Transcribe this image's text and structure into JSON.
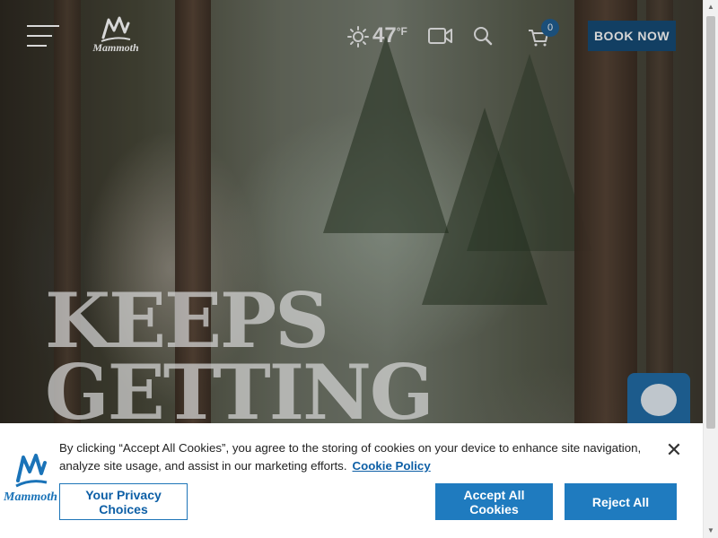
{
  "header": {
    "menu_icon": "hamburger-menu-icon",
    "logo_text": "Mammoth",
    "weather": {
      "icon": "sun-icon",
      "temperature": "47",
      "unit": "°F"
    },
    "webcam_icon": "video-camera-icon",
    "search_icon": "search-icon",
    "cart": {
      "icon": "cart-icon",
      "count": "0"
    },
    "book_label": "BOOK NOW"
  },
  "hero": {
    "headline_line1": "KEEPS",
    "headline_line2": "GETTING"
  },
  "chat": {
    "icon": "chat-bubble-icon"
  },
  "cookie_banner": {
    "logo_text": "Mammoth",
    "message": "By clicking “Accept All Cookies”, you agree to the storing of cookies on your device to enhance site navigation, analyze site usage, and assist in our marketing efforts.",
    "policy_link": "Cookie Policy",
    "privacy_choices_label": "Your Privacy Choices",
    "accept_label": "Accept All Cookies",
    "reject_label": "Reject All",
    "close_icon": "close-icon"
  },
  "colors": {
    "brand_blue": "#1f7bbf",
    "book_button": "#123f63",
    "link_blue": "#0d5fa6"
  }
}
